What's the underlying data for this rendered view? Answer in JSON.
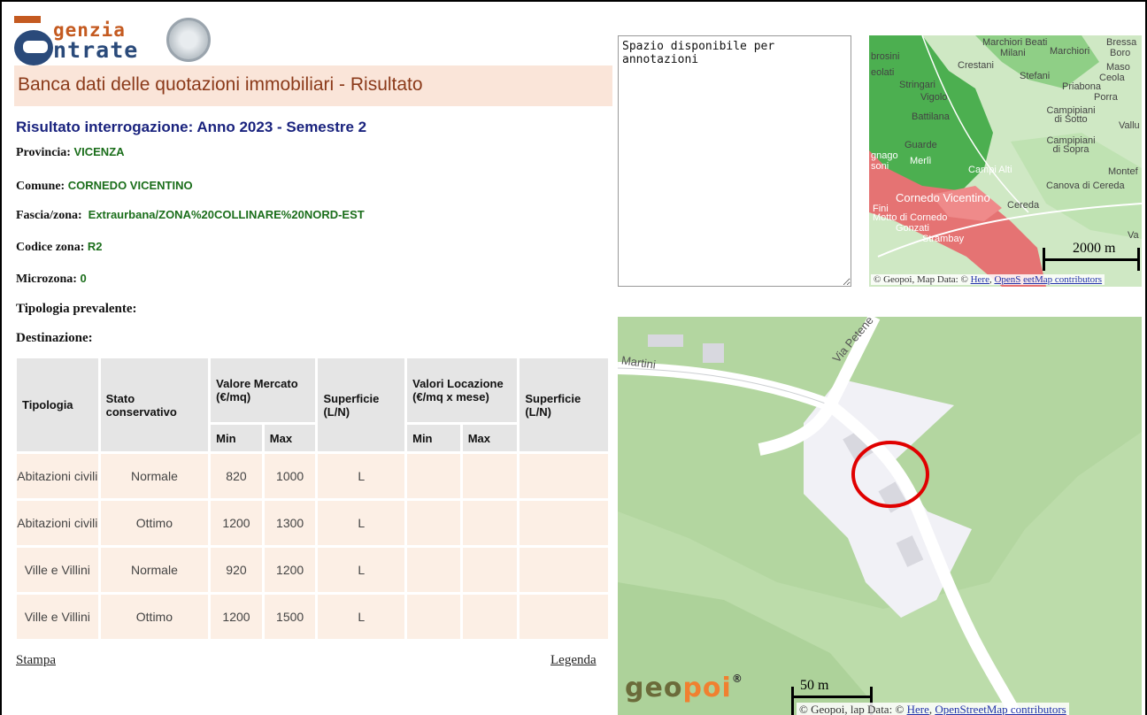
{
  "header": {
    "logo_word1": "genzia",
    "logo_word2": "ntrate",
    "banner_title": "Banca dati delle quotazioni immobiliari - Risultato"
  },
  "result": {
    "title": "Risultato interrogazione: Anno 2023 - Semestre 2",
    "fields": [
      {
        "label": "Provincia:",
        "value": "VICENZA"
      },
      {
        "label": "Comune:",
        "value": "CORNEDO VICENTINO"
      },
      {
        "label": "Fascia/zona:",
        "value": "Extraurbana/ZONA%20COLLINARE%20NORD-EST"
      },
      {
        "label": "Codice zona:",
        "value": "R2"
      },
      {
        "label": "Microzona:",
        "value": "0"
      },
      {
        "label": "Tipologia prevalente:",
        "value": ""
      },
      {
        "label": "Destinazione:",
        "value": ""
      }
    ]
  },
  "table": {
    "headers": {
      "tipologia": "Tipologia",
      "stato": "Stato conservativo",
      "valore_mercato": "Valore Mercato (€/mq)",
      "superficie1": "Superficie (L/N)",
      "valori_locazione": "Valori Locazione (€/mq x mese)",
      "superficie2": "Superficie (L/N)",
      "min": "Min",
      "max": "Max"
    },
    "rows": [
      {
        "tipologia": "Abitazioni civili",
        "stato": "Normale",
        "min": "820",
        "max": "1000",
        "superficie": "L"
      },
      {
        "tipologia": "Abitazioni civili",
        "stato": "Ottimo",
        "min": "1200",
        "max": "1300",
        "superficie": "L"
      },
      {
        "tipologia": "Ville e Villini",
        "stato": "Normale",
        "min": "920",
        "max": "1200",
        "superficie": "L"
      },
      {
        "tipologia": "Ville e Villini",
        "stato": "Ottimo",
        "min": "1200",
        "max": "1500",
        "superficie": "L"
      }
    ]
  },
  "links": {
    "stampa": "Stampa",
    "legenda": "Legenda"
  },
  "notes": {
    "text": "Spazio disponibile per annotazioni"
  },
  "map_small": {
    "labels": [
      "Marchiori Beati",
      "Bressa",
      "Milani",
      "Marchiori",
      "Boro",
      "brosini",
      "Crestani",
      "Maso",
      "Ceola",
      "eolati",
      "Stefani",
      "Priabona",
      "Stringari",
      "Vigolo",
      "Porra",
      "Battilana",
      "Campipiani di Sotto",
      "Vallu",
      "Guarde",
      "Campipiani di Sopra",
      "gnago",
      "Merlì",
      "Campi Alti",
      "Montef",
      "soni",
      "Canova di Cereda",
      "Cornedo Vicentino",
      "Fini",
      "Cereda",
      "Motto di Cornedo",
      "Gonzati",
      "Strambay",
      "Va"
    ],
    "scale": "2000 m",
    "attribution_prefix": "© Geopoi, Map Data: © ",
    "attribution_link1": "Here",
    "attribution_link2": "OpenS",
    "attribution_link3": "eetMap contributors"
  },
  "map_big": {
    "labels": [
      "Martini",
      "Via Petene"
    ],
    "scale": "50 m",
    "logo_geo": "geo",
    "logo_poi": "poi",
    "logo_mark": "®",
    "attribution_prefix": "© Geopoi,",
    "attribution_mid": "lap Data: © ",
    "attribution_link1": "Here",
    "attribution_link2": "OpenStreetMap contributors"
  },
  "colors": {
    "banner_bg": "#fae5d9",
    "banner_text": "#8b3a1a",
    "title_blue": "#1a237e",
    "value_green": "#1b6e1b",
    "map_forest": "#4caf50",
    "map_urban": "#e57373",
    "marker_red": "#e00000"
  }
}
